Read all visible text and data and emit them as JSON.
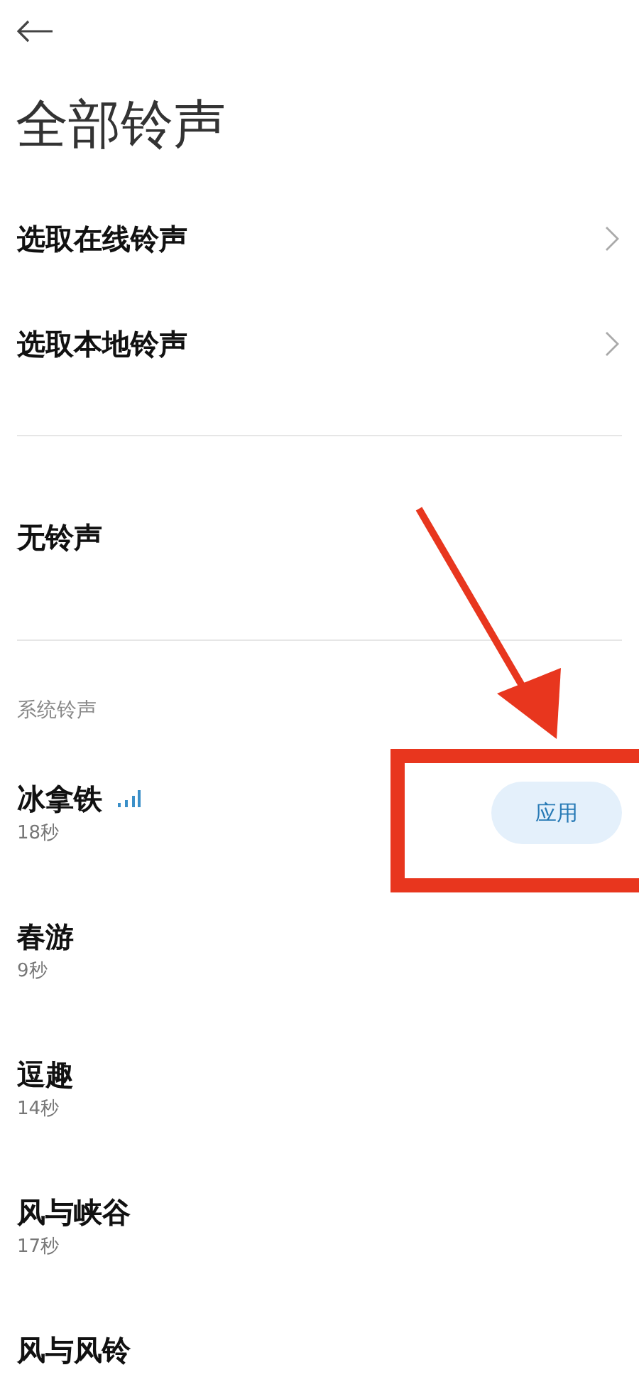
{
  "header": {
    "back_icon": true,
    "title": "全部铃声"
  },
  "nav_items": [
    {
      "label": "选取在线铃声"
    },
    {
      "label": "选取本地铃声"
    }
  ],
  "none_item": {
    "label": "无铃声"
  },
  "section": {
    "title": "系统铃声"
  },
  "ringtones": [
    {
      "name": "冰拿铁",
      "duration": "18秒",
      "playing": true,
      "action": "应用"
    },
    {
      "name": "春游",
      "duration": "9秒",
      "playing": false
    },
    {
      "name": "逗趣",
      "duration": "14秒",
      "playing": false
    },
    {
      "name": "风与峡谷",
      "duration": "17秒",
      "playing": false
    },
    {
      "name": "风与风铃",
      "playing": false
    }
  ],
  "annotation": {
    "arrow": true,
    "box": true
  }
}
